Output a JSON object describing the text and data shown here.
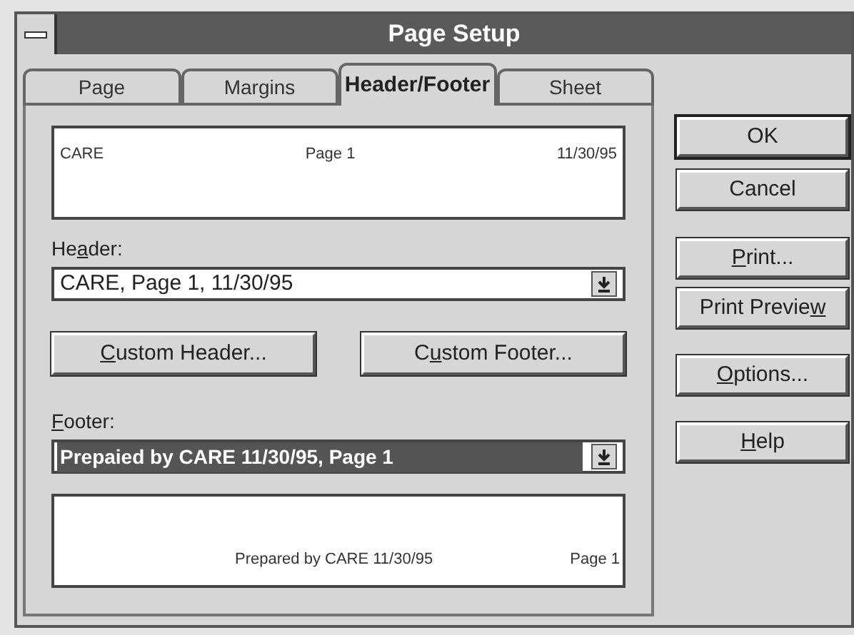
{
  "window": {
    "title": "Page Setup"
  },
  "tabs": [
    {
      "label": "Page",
      "selected": false
    },
    {
      "label": "Margins",
      "selected": false
    },
    {
      "label": "Header/Footer",
      "selected": true
    },
    {
      "label": "Sheet",
      "selected": false
    }
  ],
  "header_preview": {
    "left": "CARE",
    "center": "Page 1",
    "right": "11/30/95"
  },
  "header": {
    "label_parts": {
      "before": "He",
      "key": "a",
      "after": "der:"
    },
    "value": "CARE, Page 1, 11/30/95",
    "selected": false
  },
  "custom_buttons": [
    {
      "label_parts": {
        "key": "C",
        "after": "ustom Header..."
      }
    },
    {
      "label_parts": {
        "before": "C",
        "key": "u",
        "after": "stom Footer..."
      }
    }
  ],
  "footer": {
    "label_parts": {
      "key": "F",
      "after": "ooter:"
    },
    "value": "Prepaied by CARE 11/30/95, Page 1",
    "selected": true
  },
  "footer_preview": {
    "center": "Prepared by CARE 11/30/95",
    "right": "Page 1"
  },
  "buttons": [
    {
      "label_parts": {
        "before": "OK"
      },
      "default": true
    },
    {
      "label_parts": {
        "before": "Cancel"
      },
      "default": false
    },
    {
      "label_parts": {
        "key": "P",
        "after": "rint..."
      },
      "default": false
    },
    {
      "label_parts": {
        "before": "Print Previe",
        "key": "w"
      },
      "default": false
    },
    {
      "label_parts": {
        "key": "O",
        "after": "ptions..."
      },
      "default": false
    },
    {
      "label_parts": {
        "key": "H",
        "after": "elp"
      },
      "default": false
    }
  ]
}
